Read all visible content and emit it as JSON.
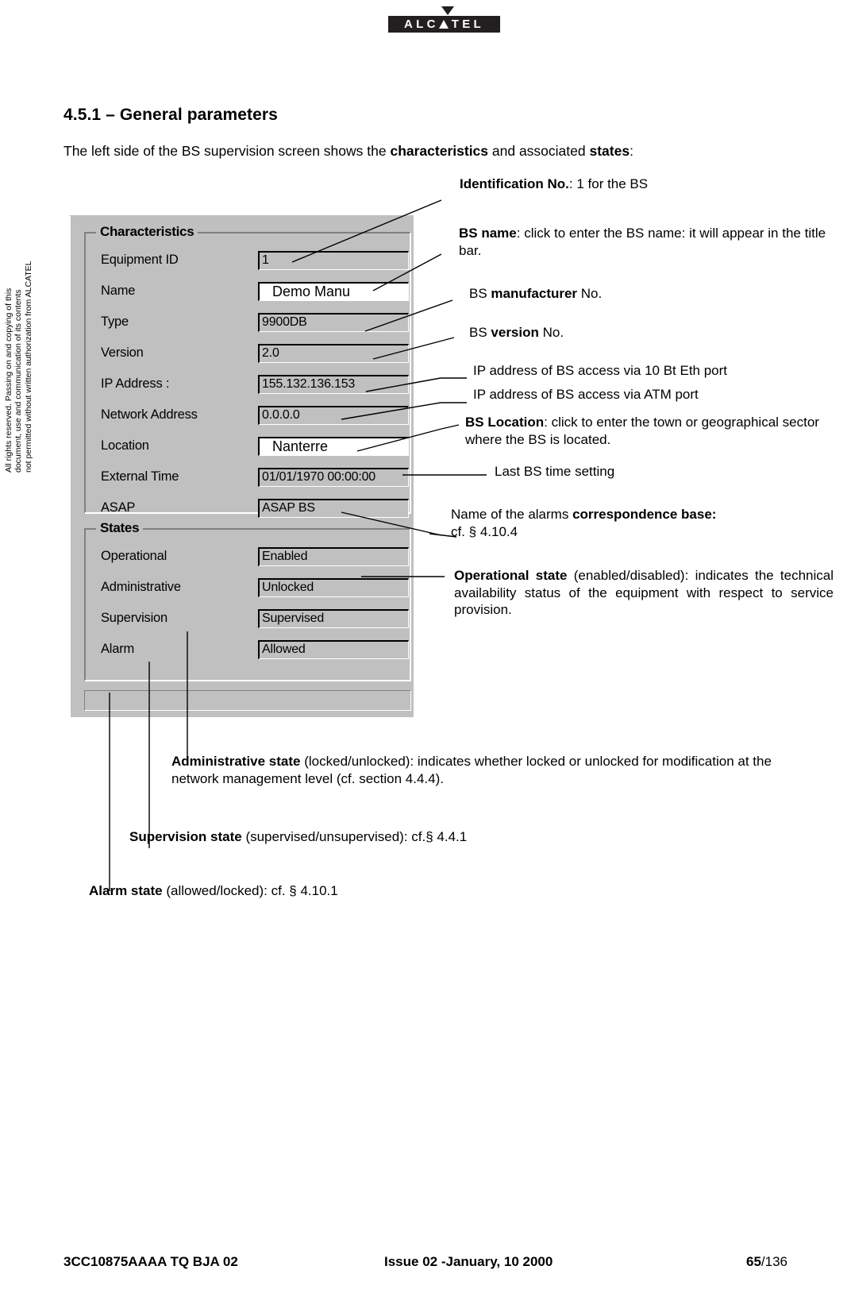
{
  "header": {
    "logo_text": "ALC TEL",
    "logo_letters": [
      "A",
      "L",
      "C",
      "T",
      "E",
      "L"
    ],
    "logo_name": "ALCATEL"
  },
  "sidebar": {
    "copyright_line1": "All rights reserved. Passing on and copying of this",
    "copyright_line2": "document, use and communication of its contents",
    "copyright_line3": "not permitted without written authorization from ALCATEL"
  },
  "page": {
    "title": "4.5.1 – General parameters",
    "intro_a": "The left side of the BS supervision screen shows the ",
    "intro_b": "characteristics",
    "intro_c": " and associated ",
    "intro_d": "states",
    "intro_e": ":"
  },
  "dialog": {
    "characteristics": {
      "group_title": "Characteristics",
      "fields": [
        {
          "label": "Equipment ID",
          "value": "1",
          "editable": false
        },
        {
          "label": "Name",
          "value": "Demo Manu",
          "editable": true
        },
        {
          "label": "Type",
          "value": "9900DB",
          "editable": false
        },
        {
          "label": "Version",
          "value": "2.0",
          "editable": false
        },
        {
          "label": "IP Address :",
          "value": "155.132.136.153",
          "editable": false
        },
        {
          "label": "Network Address",
          "value": "0.0.0.0",
          "editable": false
        },
        {
          "label": "Location",
          "value": "Nanterre",
          "editable": true
        },
        {
          "label": "External Time",
          "value": "01/01/1970 00:00:00",
          "editable": false
        },
        {
          "label": "ASAP",
          "value": "ASAP BS",
          "editable": false
        }
      ]
    },
    "states": {
      "group_title": "States",
      "fields": [
        {
          "label": "Operational",
          "value": "Enabled",
          "editable": false
        },
        {
          "label": "Administrative",
          "value": "Unlocked",
          "editable": false
        },
        {
          "label": "Supervision",
          "value": "Supervised",
          "editable": false
        },
        {
          "label": "Alarm",
          "value": "Allowed",
          "editable": false
        }
      ]
    }
  },
  "callouts": {
    "identification": {
      "bold": "Identification  No.",
      "rest": ": 1 for the BS"
    },
    "bs_name": {
      "bold": "BS name",
      "rest": ": click to enter the BS name: it will appear in the title bar."
    },
    "bs_manufacturer": {
      "pre": "BS ",
      "bold": "manufacturer",
      "rest": " No."
    },
    "bs_version": {
      "pre": "BS ",
      "bold": "version",
      "rest": " No."
    },
    "ip_eth": {
      "text": "IP address of BS access via 10 Bt Eth port"
    },
    "ip_atm": {
      "text": "IP address of BS access via ATM port"
    },
    "bs_location": {
      "bold": "BS Location",
      "rest": ": click to enter the town or geographical sector where the BS is located."
    },
    "last_time": {
      "text": "Last BS time setting"
    },
    "correspondence": {
      "pre": "Name of the alarms ",
      "bold": "correspondence base:",
      "rest": "cf. § 4.10.4"
    },
    "operational_state": {
      "bold": "Operational  state",
      "rest": " (enabled/disabled): indicates the technical availability status of the equipment with respect to service provision."
    },
    "administrative_state": {
      "bold": "Administrative state",
      "rest": " (locked/unlocked): indicates whether locked or unlocked for modification at the network management level (cf. section 4.4.4)."
    },
    "supervision_state": {
      "bold": "Supervision state",
      "rest": " (supervised/unsupervised): cf.§ 4.4.1"
    },
    "alarm_state": {
      "bold": "Alarm state",
      "rest": " (allowed/locked): cf. § 4.10.1"
    }
  },
  "footer": {
    "left": "3CC10875AAAA TQ BJA 02",
    "center": "Issue 02 -January, 10 2000",
    "page_current": "65",
    "page_total": "/136"
  }
}
